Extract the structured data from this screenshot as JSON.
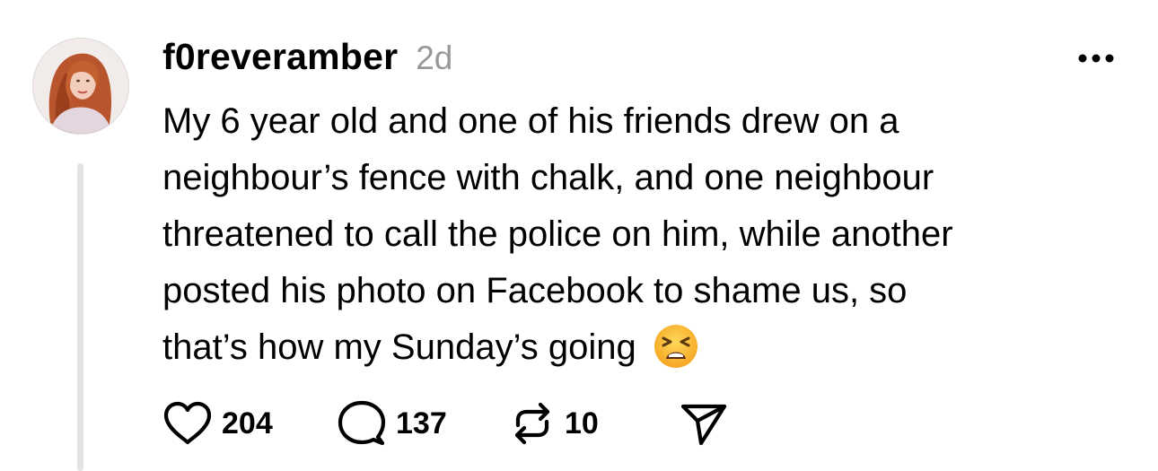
{
  "post": {
    "username": "f0reveramber",
    "timestamp": "2d",
    "body_lines": [
      "My 6 year old and one of his friends drew on a",
      "neighbour’s fence with chalk, and one neighbour",
      "threatened to call the police on him, while another",
      "posted his photo on Facebook to shame us, so",
      "that’s how my Sunday’s going"
    ],
    "emoji": "tired-face-emoji",
    "avatar": "user-avatar-photo",
    "actions": {
      "likes": "204",
      "replies": "137",
      "reposts": "10"
    },
    "icons": {
      "like": "heart-icon",
      "reply": "speech-bubble-icon",
      "repost": "repost-arrows-icon",
      "share": "send-icon",
      "more": "more-icon"
    },
    "colors": {
      "text": "#000000",
      "muted": "#999999",
      "thread_line": "#e3e3e3"
    }
  }
}
